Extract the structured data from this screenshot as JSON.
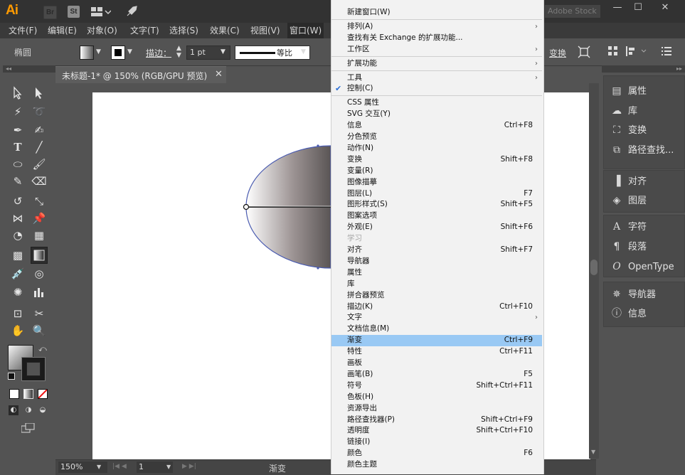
{
  "titlebar": {
    "app_logo": "Ai",
    "bridge_label": "Br",
    "stock_label": "St",
    "adobe_stock_search": "Adobe Stock",
    "minimize": "—",
    "maximize": "☐",
    "close": "✕"
  },
  "menubar": {
    "items": [
      "文件(F)",
      "编辑(E)",
      "对象(O)",
      "文字(T)",
      "选择(S)",
      "效果(C)",
      "视图(V)",
      "窗口(W)"
    ]
  },
  "controlbar": {
    "object_type": "椭圆",
    "stroke_label": "描边：",
    "stroke_value": "1 pt",
    "stroke_profile": "等比",
    "transform_label": "变换"
  },
  "document": {
    "tab_title": "未标题-1* @ 150% (RGB/GPU 预览)",
    "close_icon": "✕"
  },
  "status": {
    "zoom": "150%",
    "page": "1",
    "current_tool": "渐变"
  },
  "right_panels": [
    {
      "label": "属性",
      "icon": "properties-icon"
    },
    {
      "label": "库",
      "icon": "libraries-icon"
    },
    {
      "label": "变换",
      "icon": "transform-icon"
    },
    {
      "label": "路径查找...",
      "icon": "pathfinder-icon"
    },
    {
      "label": "对齐",
      "icon": "align-icon"
    },
    {
      "label": "图层",
      "icon": "layers-icon"
    },
    {
      "label": "字符",
      "icon": "character-icon"
    },
    {
      "label": "段落",
      "icon": "paragraph-icon"
    },
    {
      "label": "OpenType",
      "icon": "opentype-icon"
    },
    {
      "label": "导航器",
      "icon": "navigator-icon"
    },
    {
      "label": "信息",
      "icon": "info-icon"
    }
  ],
  "window_menu": {
    "items": [
      {
        "label": "新建窗口(W)",
        "shortcut": ""
      },
      {
        "sep": true
      },
      {
        "label": "排列(A)",
        "shortcut": "",
        "submenu": true
      },
      {
        "label": "查找有关 Exchange 的扩展功能...",
        "shortcut": ""
      },
      {
        "label": "工作区",
        "shortcut": "",
        "submenu": true
      },
      {
        "sep": true
      },
      {
        "label": "扩展功能",
        "shortcut": "",
        "submenu": true
      },
      {
        "sep": true
      },
      {
        "label": "工具",
        "shortcut": "",
        "submenu": true
      },
      {
        "label": "控制(C)",
        "shortcut": "",
        "checked": true
      },
      {
        "sep": true
      },
      {
        "label": "CSS 属性",
        "shortcut": ""
      },
      {
        "label": "SVG 交互(Y)",
        "shortcut": ""
      },
      {
        "label": "信息",
        "shortcut": "Ctrl+F8"
      },
      {
        "label": "分色预览",
        "shortcut": ""
      },
      {
        "label": "动作(N)",
        "shortcut": ""
      },
      {
        "label": "变换",
        "shortcut": "Shift+F8"
      },
      {
        "label": "变量(R)",
        "shortcut": ""
      },
      {
        "label": "图像描摹",
        "shortcut": ""
      },
      {
        "label": "图层(L)",
        "shortcut": "F7"
      },
      {
        "label": "图形样式(S)",
        "shortcut": "Shift+F5"
      },
      {
        "label": "图案选项",
        "shortcut": ""
      },
      {
        "label": "外观(E)",
        "shortcut": "Shift+F6"
      },
      {
        "label": "学习",
        "shortcut": "",
        "disabled": true
      },
      {
        "label": "对齐",
        "shortcut": "Shift+F7"
      },
      {
        "label": "导航器",
        "shortcut": ""
      },
      {
        "label": "属性",
        "shortcut": ""
      },
      {
        "label": "库",
        "shortcut": ""
      },
      {
        "label": "拼合器预览",
        "shortcut": ""
      },
      {
        "label": "描边(K)",
        "shortcut": "Ctrl+F10"
      },
      {
        "label": "文字",
        "shortcut": "",
        "submenu": true
      },
      {
        "label": "文档信息(M)",
        "shortcut": ""
      },
      {
        "label": "渐变",
        "shortcut": "Ctrl+F9",
        "highlighted": true
      },
      {
        "label": "特性",
        "shortcut": "Ctrl+F11"
      },
      {
        "label": "画板",
        "shortcut": ""
      },
      {
        "label": "画笔(B)",
        "shortcut": "F5"
      },
      {
        "label": "符号",
        "shortcut": "Shift+Ctrl+F11"
      },
      {
        "label": "色板(H)",
        "shortcut": ""
      },
      {
        "label": "资源导出",
        "shortcut": ""
      },
      {
        "label": "路径查找器(P)",
        "shortcut": "Shift+Ctrl+F9"
      },
      {
        "label": "透明度",
        "shortcut": "Shift+Ctrl+F10"
      },
      {
        "label": "链接(I)",
        "shortcut": ""
      },
      {
        "label": "颜色",
        "shortcut": "F6"
      },
      {
        "label": "颜色主题",
        "shortcut": ""
      }
    ]
  },
  "colors": {
    "menu_highlight": "#99c9f4",
    "ellipse_stroke": "#4a5bb0",
    "checkmark": "#2b6fd6"
  }
}
